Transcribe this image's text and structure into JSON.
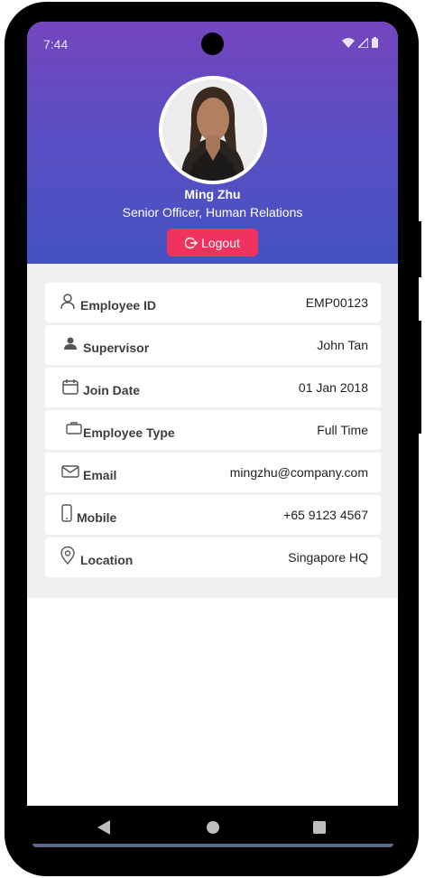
{
  "status_bar": {
    "time": "7:44"
  },
  "profile": {
    "name": "Ming Zhu",
    "title": "Senior Officer, Human Relations",
    "logout_label": "Logout"
  },
  "details": [
    {
      "icon": "person-outline-icon",
      "label": "Employee ID",
      "value": "EMP00123"
    },
    {
      "icon": "person-filled-icon",
      "label": "Supervisor",
      "value": "John Tan"
    },
    {
      "icon": "calendar-icon",
      "label": "Join Date",
      "value": "01 Jan 2018"
    },
    {
      "icon": "briefcase-icon",
      "label": "Employee Type",
      "value": "Full Time"
    },
    {
      "icon": "email-icon",
      "label": "Email",
      "value": "mingzhu@company.com"
    },
    {
      "icon": "mobile-phone-icon",
      "label": "Mobile",
      "value": "+65 9123 4567"
    },
    {
      "icon": "location-pin-icon",
      "label": "Location",
      "value": "Singapore HQ"
    }
  ],
  "colors": {
    "header_gradient_top": "#7445bd",
    "header_gradient_bottom": "#4452bf",
    "logout_button": "#f0335e",
    "content_background": "#f0f0f2"
  }
}
